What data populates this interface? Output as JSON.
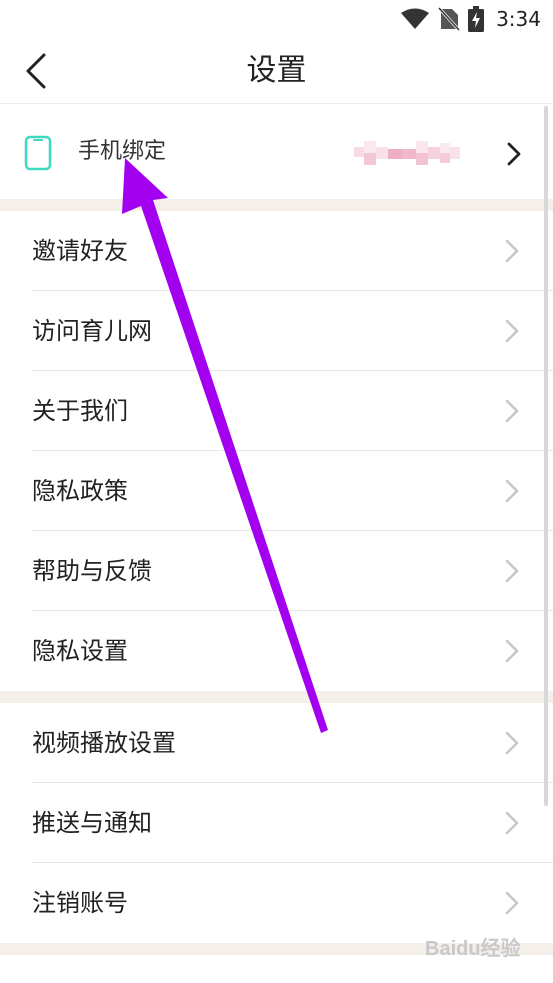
{
  "status_bar": {
    "time": "3:34",
    "icons": [
      "wifi-icon",
      "no-sim-icon",
      "battery-charging-icon"
    ]
  },
  "header": {
    "title": "设置",
    "back_icon": "chevron-left-icon"
  },
  "phone_binding": {
    "label": "手机绑定",
    "icon": "phone-icon",
    "icon_color": "#3dd9c0",
    "value_state": "pixelated"
  },
  "groups": [
    {
      "items": [
        {
          "label": "邀请好友"
        },
        {
          "label": "访问育儿网"
        },
        {
          "label": "关于我们"
        },
        {
          "label": "隐私政策"
        },
        {
          "label": "帮助与反馈"
        },
        {
          "label": "隐私设置"
        }
      ]
    },
    {
      "items": [
        {
          "label": "视频播放设置"
        },
        {
          "label": "推送与通知"
        },
        {
          "label": "注销账号"
        }
      ]
    }
  ],
  "annotation": {
    "color": "#a400f0"
  },
  "watermark": {
    "text": "Baidu经验"
  },
  "colors": {
    "section_gap": "#f5efea",
    "divider": "#e6e6e6",
    "chevron": "#c6c6c6"
  }
}
